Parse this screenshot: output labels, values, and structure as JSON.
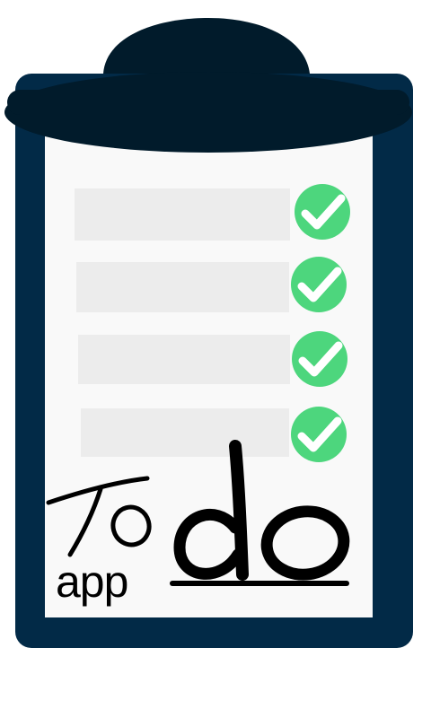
{
  "logo": {
    "to_text": "To",
    "do_text": "do",
    "app_text": "app"
  },
  "checklist": {
    "items": [
      {
        "checked": true
      },
      {
        "checked": true
      },
      {
        "checked": true
      },
      {
        "checked": true
      }
    ]
  },
  "colors": {
    "board": "#022a47",
    "clip": "#011b2b",
    "paper": "#f9f9f9",
    "line": "#ececec",
    "check": "#4dd67d",
    "ink": "#000000"
  },
  "icons": {
    "check": "check-circle-icon",
    "clip": "clipboard-clip-icon"
  }
}
